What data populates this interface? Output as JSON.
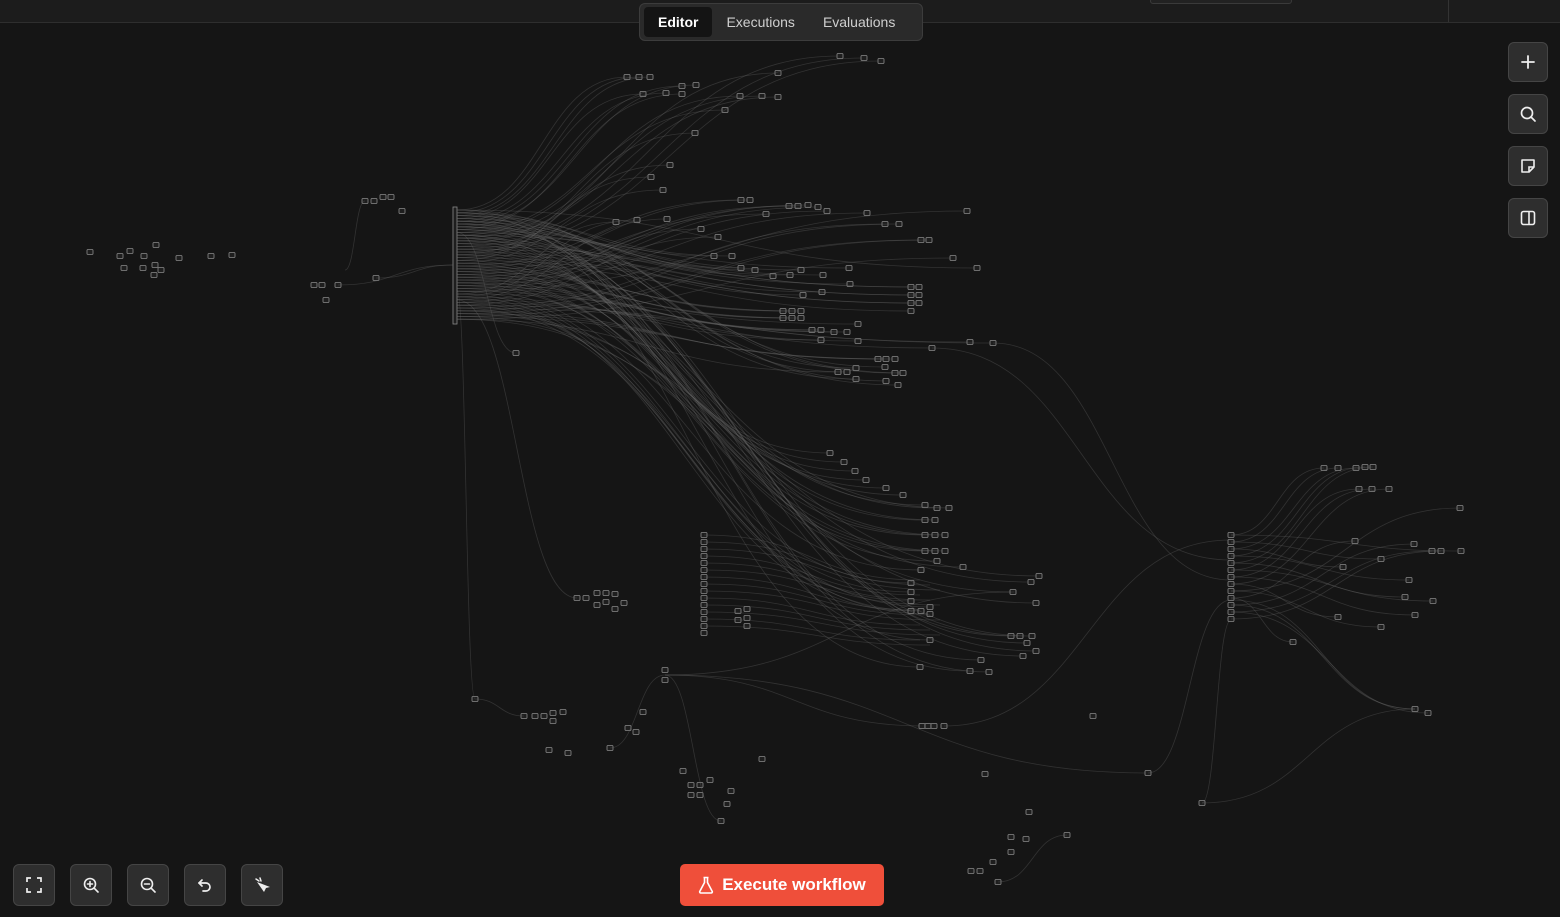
{
  "tabs": [
    {
      "label": "Editor",
      "active": true
    },
    {
      "label": "Executions",
      "active": false
    },
    {
      "label": "Evaluations",
      "active": false
    }
  ],
  "right_toolbar": [
    {
      "icon": "plus-icon"
    },
    {
      "icon": "search-icon"
    },
    {
      "icon": "sticky-note-icon"
    },
    {
      "icon": "panel-toggle-icon"
    }
  ],
  "bottom_toolbar": [
    {
      "icon": "fit-view-icon"
    },
    {
      "icon": "zoom-in-icon"
    },
    {
      "icon": "zoom-out-icon"
    },
    {
      "icon": "undo-icon"
    },
    {
      "icon": "clean-up-icon"
    }
  ],
  "execute_button": {
    "label": "Execute workflow",
    "icon": "flask-icon"
  },
  "colors": {
    "canvas": "#151515",
    "accent": "#ef4f3a"
  }
}
